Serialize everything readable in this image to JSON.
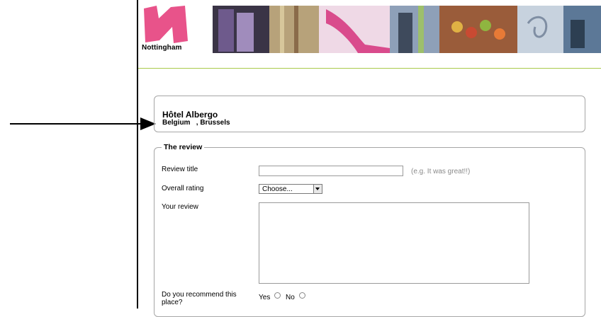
{
  "header": {
    "logo_text": "Nottingham",
    "colors": {
      "logo_pink": "#e8538a",
      "header_rule": "#a9c94a"
    }
  },
  "hotel": {
    "name": "Hôtel Albergo",
    "location": "Belgium   , Brussels"
  },
  "review_form": {
    "legend": "The review",
    "title_label": "Review title",
    "title_value": "",
    "title_hint": "(e.g. It was great!!)",
    "rating_label": "Overall rating",
    "rating_selected": "Choose...",
    "review_label": "Your review",
    "review_value": "",
    "recommend_label": "Do you recommend this place?",
    "yes_label": "Yes",
    "no_label": "No"
  }
}
